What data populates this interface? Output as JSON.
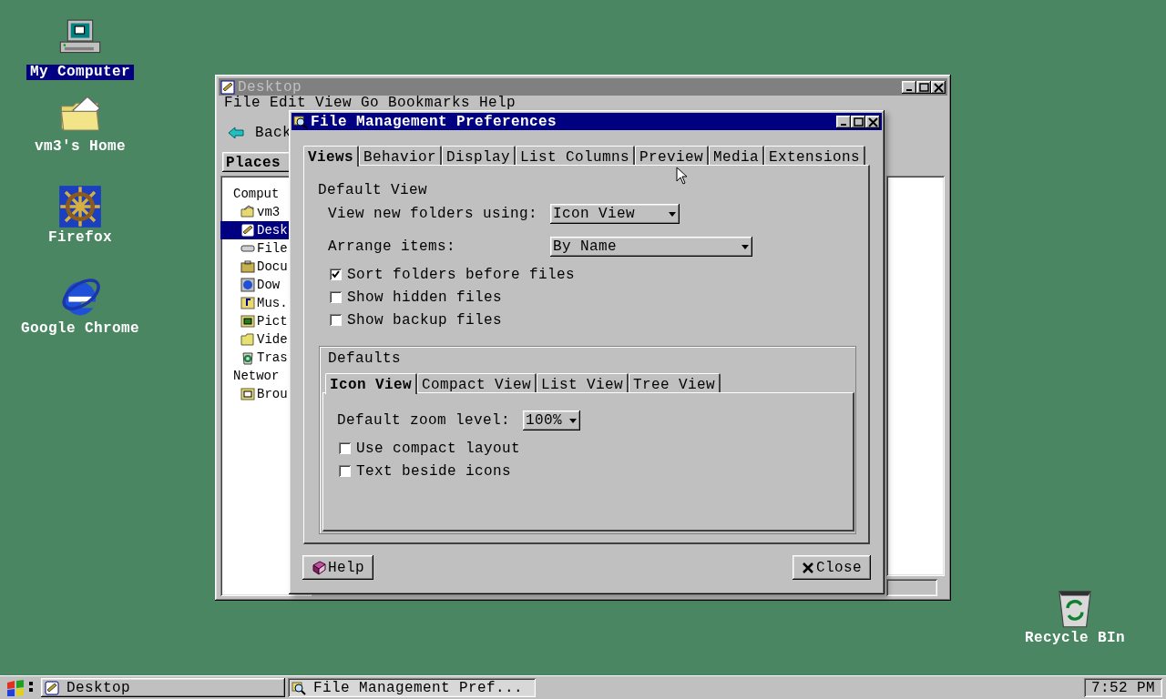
{
  "desktop_icons": [
    {
      "label": "My Computer",
      "selected": true
    },
    {
      "label": "vm3's Home",
      "selected": false
    },
    {
      "label": "Firefox",
      "selected": false
    },
    {
      "label": "Google Chrome",
      "selected": false
    },
    {
      "label": "Recycle BIn",
      "selected": false
    }
  ],
  "explorer_window": {
    "title": "Desktop",
    "menu": [
      "File",
      "Edit",
      "View",
      "Go",
      "Bookmarks",
      "Help"
    ],
    "back_button": "Back",
    "sidebar_header": "Places",
    "tree": [
      {
        "label": "Comput",
        "children": [
          {
            "label": "vm3",
            "selected": false
          },
          {
            "label": "Desk",
            "selected": true
          },
          {
            "label": "File",
            "selected": false
          },
          {
            "label": "Docu",
            "selected": false
          },
          {
            "label": "Dow",
            "selected": false
          },
          {
            "label": "Mus.",
            "selected": false
          },
          {
            "label": "Pict",
            "selected": false
          },
          {
            "label": "Vide",
            "selected": false
          },
          {
            "label": "Tras",
            "selected": false
          }
        ]
      },
      {
        "label": "Networ",
        "children": [
          {
            "label": "Brou",
            "selected": false
          }
        ]
      }
    ]
  },
  "dialog": {
    "title": "File Management Preferences",
    "tabs": [
      {
        "label": "Views",
        "selected": true
      },
      {
        "label": "Behavior",
        "selected": false
      },
      {
        "label": "Display",
        "selected": false
      },
      {
        "label": "List Columns",
        "selected": false
      },
      {
        "label": "Preview",
        "selected": false
      },
      {
        "label": "Media",
        "selected": false
      },
      {
        "label": "Extensions",
        "selected": false
      }
    ],
    "section_title": "Default View",
    "fields": [
      {
        "label": "View new folders using:",
        "value": "Icon View"
      },
      {
        "label": "Arrange items:",
        "value": "By Name"
      }
    ],
    "checkboxes": [
      {
        "label": "Sort folders before files",
        "checked": true
      },
      {
        "label": "Show hidden files",
        "checked": false
      },
      {
        "label": "Show backup files",
        "checked": false
      }
    ],
    "defaults": {
      "title": "Defaults",
      "tabs": [
        {
          "label": "Icon View",
          "selected": true
        },
        {
          "label": "Compact View",
          "selected": false
        },
        {
          "label": "List View",
          "selected": false
        },
        {
          "label": "Tree View",
          "selected": false
        }
      ],
      "zoom": {
        "label": "Default zoom level:",
        "value": "100%"
      },
      "checkboxes": [
        {
          "label": "Use compact layout",
          "checked": false
        },
        {
          "label": "Text beside icons",
          "checked": false
        }
      ]
    },
    "buttons": [
      {
        "label": "Help",
        "kind": "help"
      },
      {
        "label": "Close",
        "kind": "close"
      }
    ]
  },
  "taskbar": {
    "tasks": [
      {
        "label": "Desktop",
        "selected": false
      },
      {
        "label": "File Management Pref...",
        "selected": true
      }
    ],
    "clock": "7:52 PM"
  }
}
